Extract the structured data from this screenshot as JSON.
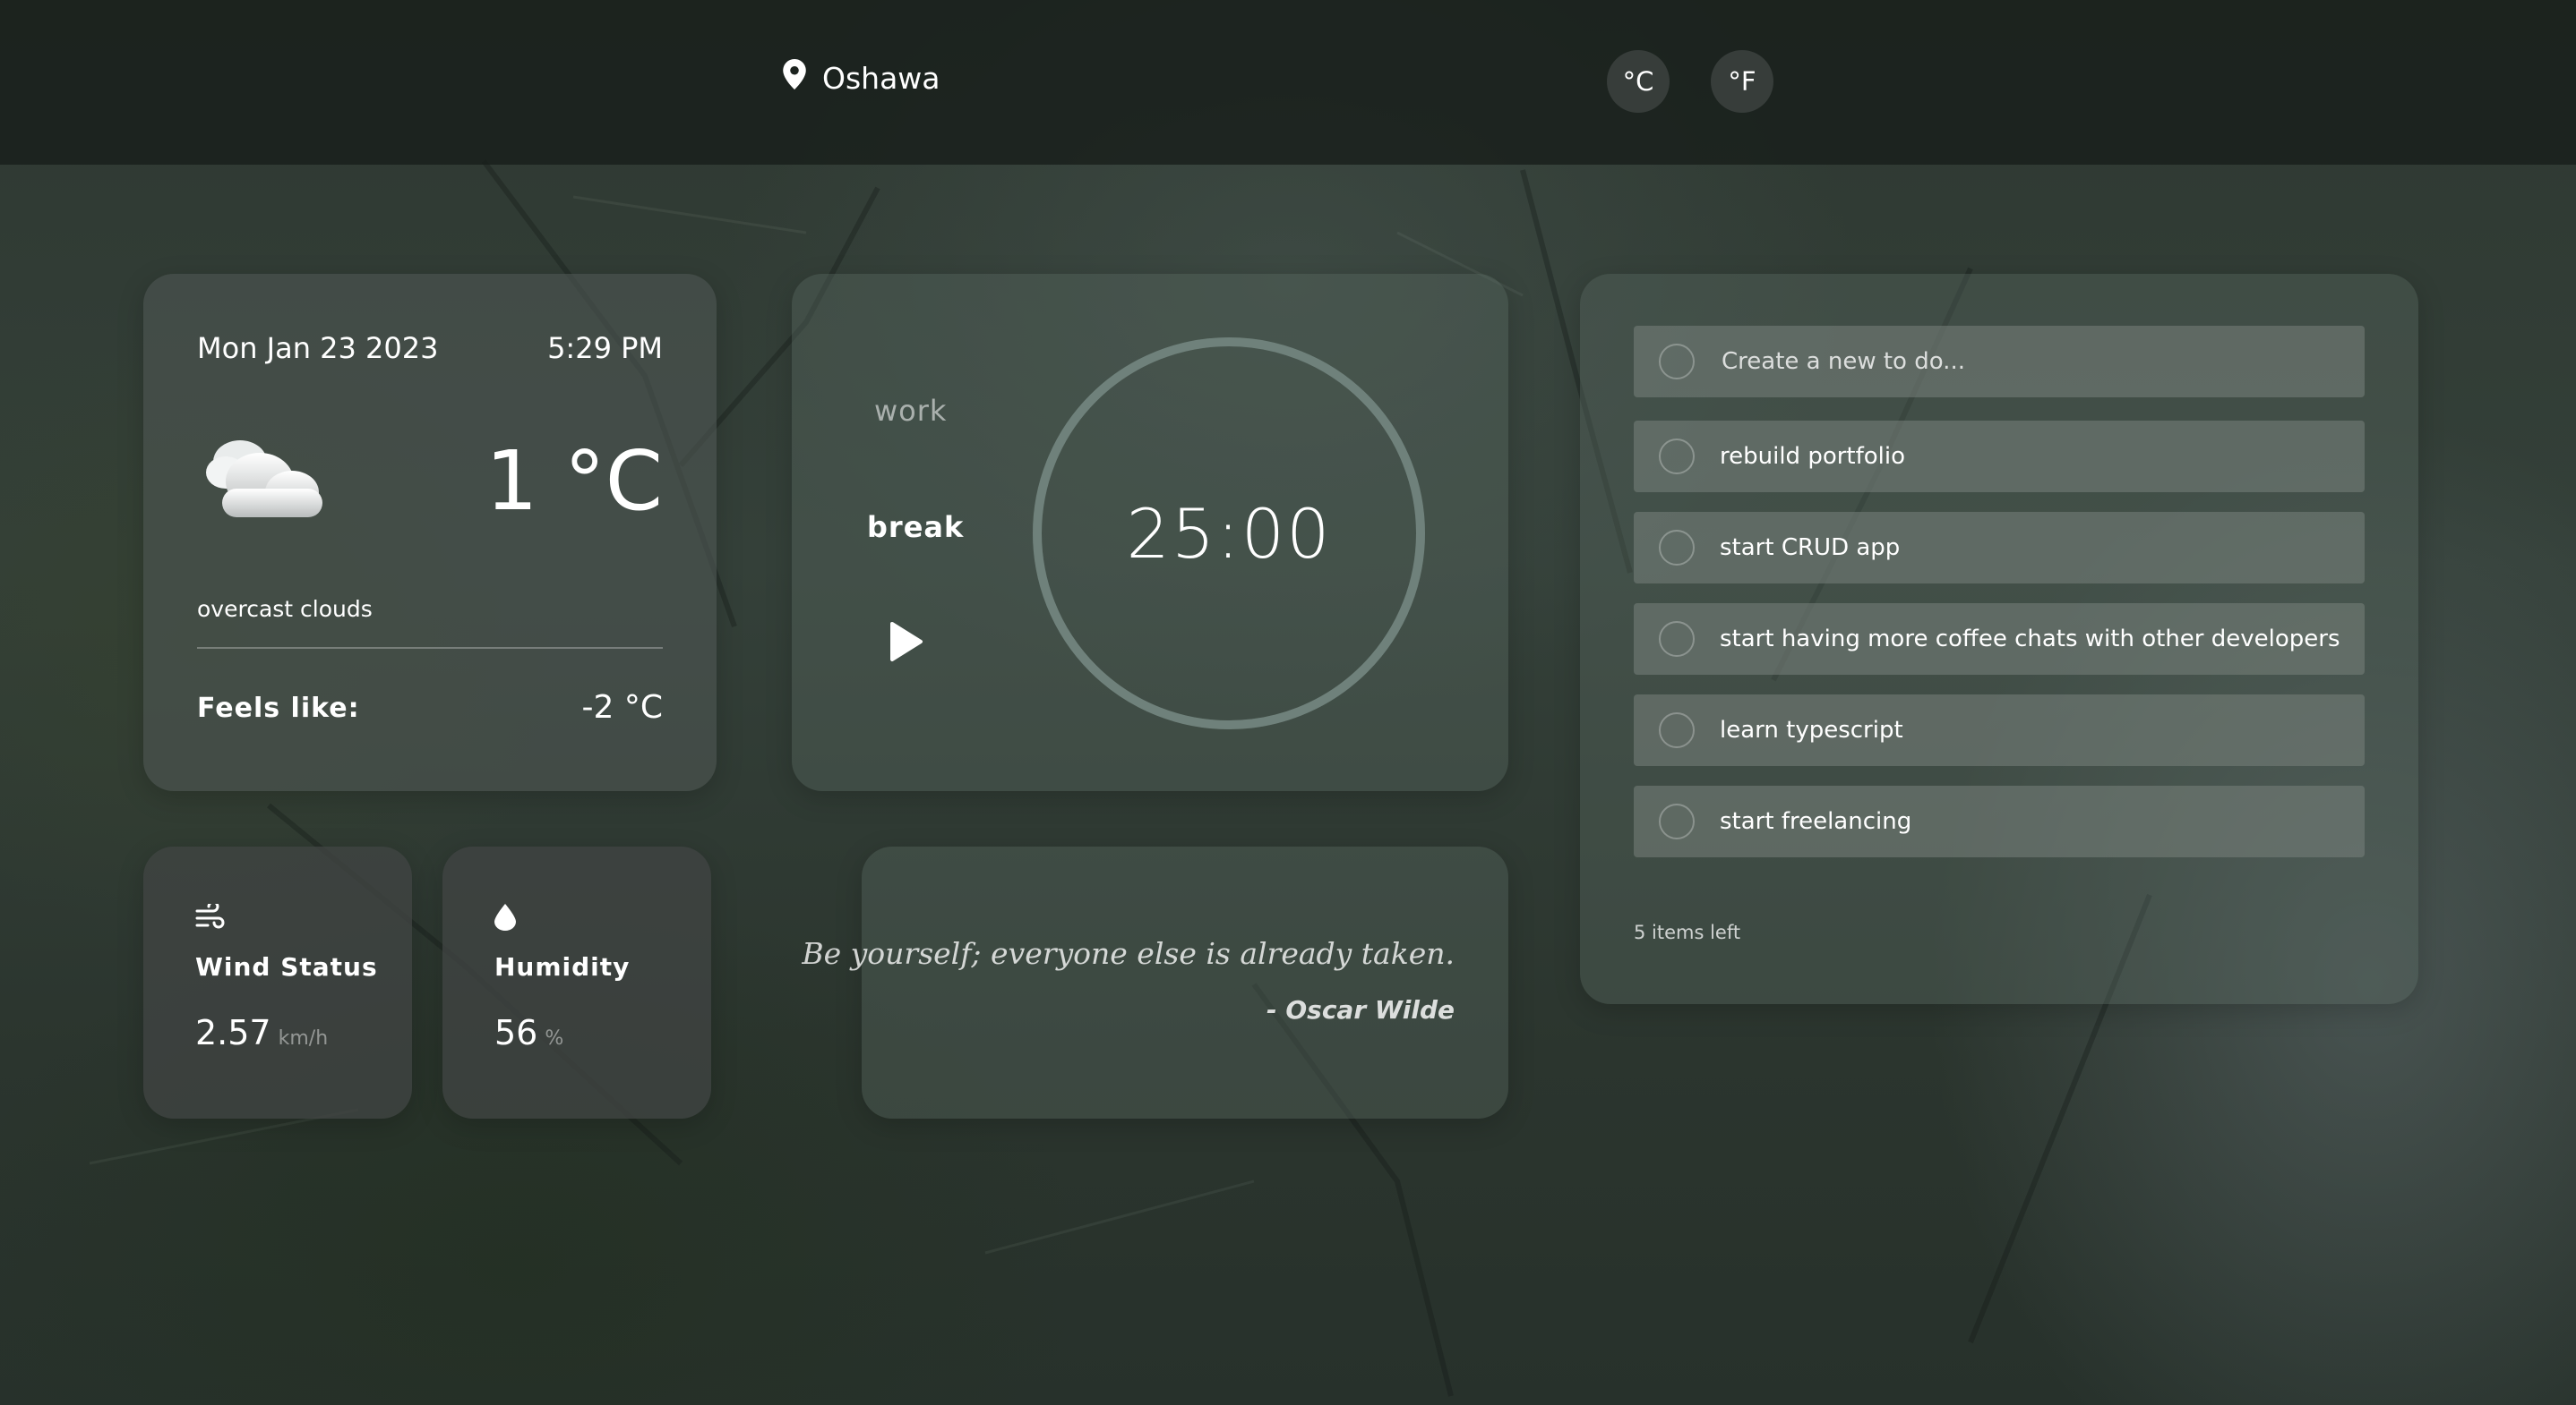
{
  "header": {
    "location": "Oshawa",
    "units": [
      "°C",
      "°F"
    ]
  },
  "weather": {
    "date": "Mon Jan 23 2023",
    "time": "5:29 PM",
    "temperature": "1 °C",
    "description": "overcast clouds",
    "feels_like_label": "Feels like:",
    "feels_like_value": "-2 °C",
    "icon": "cloud-icon"
  },
  "wind": {
    "label": "Wind Status",
    "value": "2.57",
    "unit": "km/h",
    "icon": "wind-icon"
  },
  "humidity": {
    "label": "Humidity",
    "value": "56",
    "unit": "%",
    "icon": "droplet-icon"
  },
  "timer": {
    "modes": [
      "work",
      "break"
    ],
    "active_mode": "break",
    "display": "25:00",
    "progress": 1.0
  },
  "quote": {
    "text": "Be yourself; everyone else is already taken.",
    "author": "- Oscar Wilde"
  },
  "todos": {
    "placeholder": "Create a new to do...",
    "items": [
      "rebuild portfolio",
      "start CRUD app",
      "start having more coffee chats with other developers",
      "learn typescript",
      "start freelancing"
    ],
    "items_left": "5 items left"
  },
  "colors": {
    "accent_ring": "#6f817b",
    "card": "#4e5652",
    "todo_row": "#78827c"
  }
}
